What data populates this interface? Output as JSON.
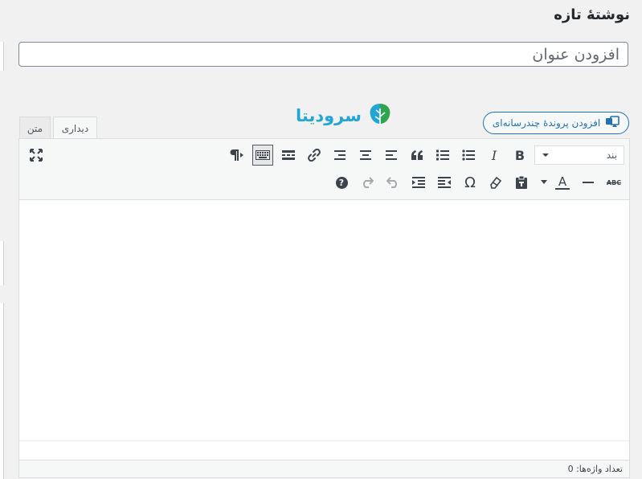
{
  "page": {
    "title": "نوشتهٔ تازه"
  },
  "title_field": {
    "placeholder": "افزودن عنوان"
  },
  "brand": {
    "name": "سرودیتا"
  },
  "media": {
    "add_media_label": "افزودن پروندهٔ چندرسانه‌ای"
  },
  "tabs": {
    "visual": "دیداری",
    "text": "متن"
  },
  "toolbar": {
    "format_select_value": "بند",
    "bold": "B",
    "italic": "I",
    "omega": "Ω",
    "strike": "ABC",
    "text_color": "A",
    "help": "?"
  },
  "status": {
    "word_count": "تعداد واژه‌ها: 0"
  },
  "colors": {
    "accent": "#2271b1",
    "brand": "#23a6d5",
    "brand_leaf": "#2ea44f"
  }
}
